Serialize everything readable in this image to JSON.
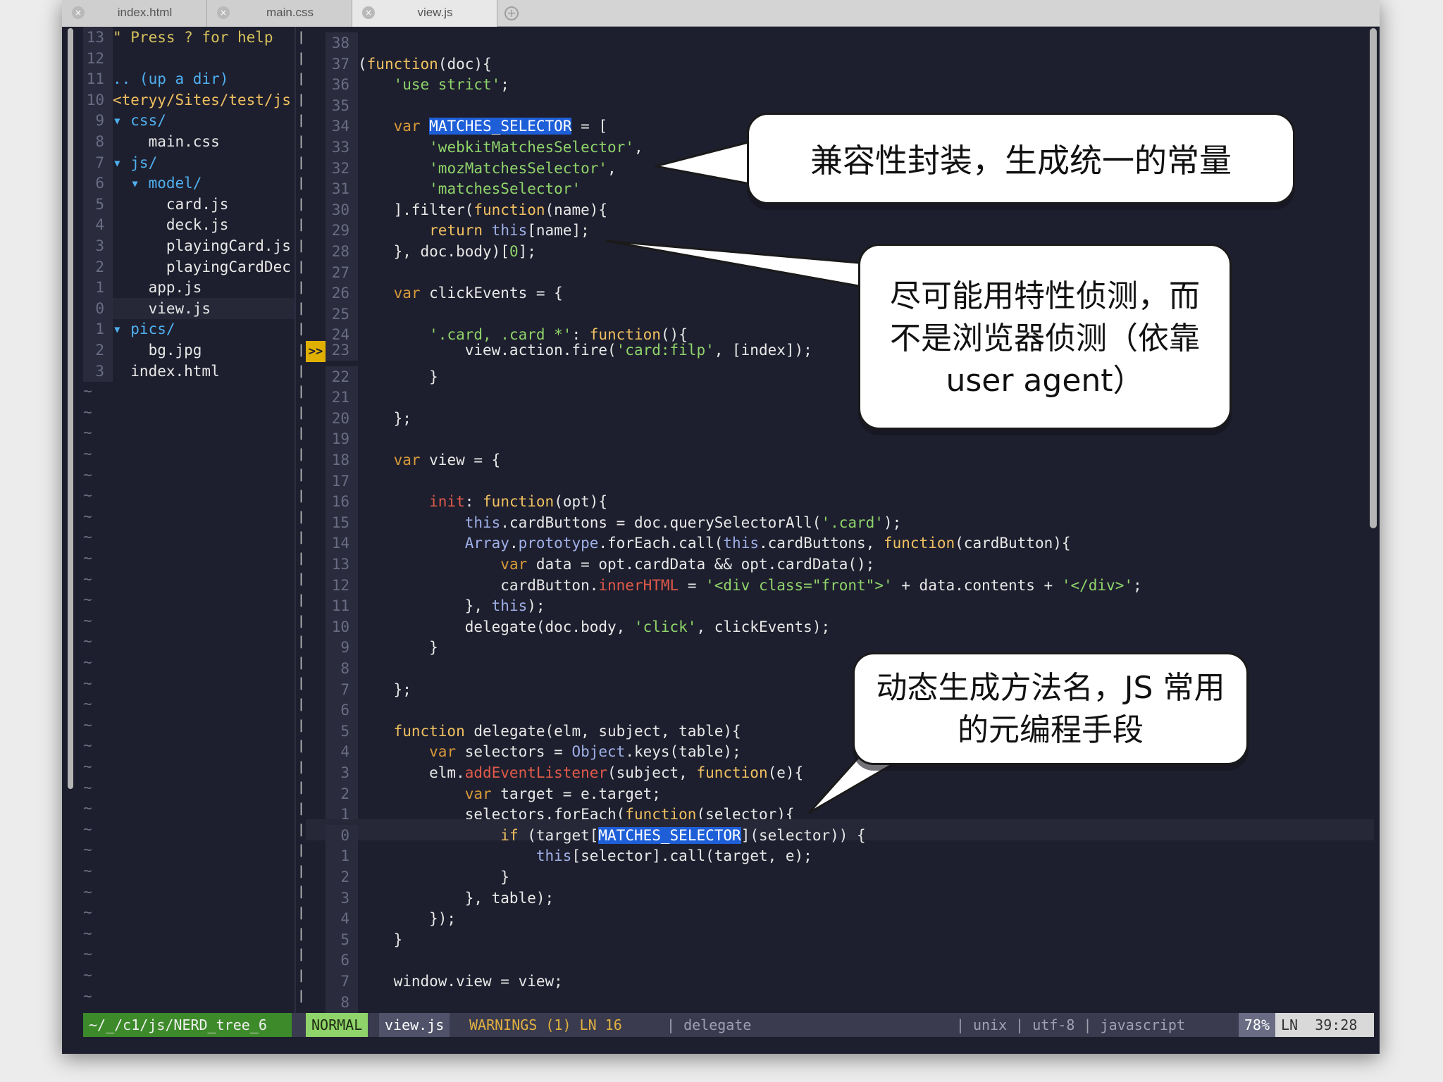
{
  "tabs": [
    {
      "label": "index.html",
      "active": false
    },
    {
      "label": "main.css",
      "active": false
    },
    {
      "label": "view.js",
      "active": true
    }
  ],
  "tree": {
    "lines": [
      {
        "n": "13",
        "text": "\" Press ? for help",
        "cls": "comment"
      },
      {
        "n": "12",
        "text": "",
        "cls": ""
      },
      {
        "n": "11",
        "text": ".. (up a dir)",
        "cls": "dir"
      },
      {
        "n": "10",
        "text": "<teryy/Sites/test/js",
        "cls": "fn"
      },
      {
        "n": "9",
        "text": "▾ css/",
        "cls": "dir"
      },
      {
        "n": "8",
        "text": "    main.css",
        "cls": ""
      },
      {
        "n": "7",
        "text": "▾ js/",
        "cls": "dir"
      },
      {
        "n": "6",
        "text": "  ▾ model/",
        "cls": "dir"
      },
      {
        "n": "5",
        "text": "      card.js",
        "cls": ""
      },
      {
        "n": "4",
        "text": "      deck.js",
        "cls": ""
      },
      {
        "n": "3",
        "text": "      playingCard.js",
        "cls": ""
      },
      {
        "n": "2",
        "text": "      playingCardDec",
        "cls": ""
      },
      {
        "n": "1",
        "text": "    app.js",
        "cls": ""
      },
      {
        "n": "0",
        "text": "    view.js",
        "cls": "",
        "current": true
      },
      {
        "n": "1",
        "text": "▾ pics/",
        "cls": "dir"
      },
      {
        "n": "2",
        "text": "    bg.jpg",
        "cls": ""
      },
      {
        "n": "3",
        "text": "  index.html",
        "cls": ""
      }
    ],
    "tilde": "~"
  },
  "code": {
    "lines": [
      {
        "n": "38",
        "t": []
      },
      {
        "n": "37",
        "t": [
          [
            "(",
            ""
          ],
          [
            "function",
            "fn"
          ],
          [
            "(doc){",
            ""
          ]
        ]
      },
      {
        "n": "36",
        "t": [
          [
            "    ",
            ""
          ],
          [
            "'use strict'",
            "str"
          ],
          [
            ";",
            ""
          ]
        ]
      },
      {
        "n": "35",
        "t": []
      },
      {
        "n": "34",
        "t": [
          [
            "    ",
            ""
          ],
          [
            "var",
            "kw"
          ],
          [
            " ",
            ""
          ],
          [
            "MATCHES_SELECTOR",
            "sel"
          ],
          [
            " = [",
            ""
          ]
        ]
      },
      {
        "n": "33",
        "t": [
          [
            "        ",
            ""
          ],
          [
            "'webkitMatchesSelector'",
            "str"
          ],
          [
            ",",
            ""
          ]
        ]
      },
      {
        "n": "32",
        "t": [
          [
            "        ",
            ""
          ],
          [
            "'mozMatchesSelector'",
            "str"
          ],
          [
            ",",
            ""
          ]
        ]
      },
      {
        "n": "31",
        "t": [
          [
            "        ",
            ""
          ],
          [
            "'matchesSelector'",
            "str"
          ]
        ]
      },
      {
        "n": "30",
        "t": [
          [
            "    ].filter(",
            ""
          ],
          [
            "function",
            "fn"
          ],
          [
            "(name){",
            ""
          ]
        ]
      },
      {
        "n": "29",
        "t": [
          [
            "        ",
            ""
          ],
          [
            "return",
            "fn"
          ],
          [
            " ",
            ""
          ],
          [
            "this",
            "obj"
          ],
          [
            "[name];",
            ""
          ]
        ]
      },
      {
        "n": "28",
        "t": [
          [
            "    }, doc.body)[",
            ""
          ],
          [
            "0",
            "str"
          ],
          [
            "];",
            ""
          ]
        ]
      },
      {
        "n": "27",
        "t": []
      },
      {
        "n": "26",
        "t": [
          [
            "    ",
            ""
          ],
          [
            "var",
            "kw"
          ],
          [
            " clickEvents = {",
            ""
          ]
        ]
      },
      {
        "n": "25",
        "t": []
      },
      {
        "n": "24",
        "t": [
          [
            "        ",
            ""
          ],
          [
            "'.card, .card *'",
            "str"
          ],
          [
            ": ",
            ""
          ],
          [
            "function",
            "fn"
          ],
          [
            "(){",
            ""
          ]
        ]
      },
      {
        "n": "23",
        "t": [
          [
            "            view.action.fire(",
            ""
          ],
          [
            "'card:filp'",
            "str"
          ],
          [
            ", [index]);",
            ""
          ]
        ],
        "warn": true
      },
      {
        "n": "22",
        "t": [
          [
            "        }",
            ""
          ]
        ]
      },
      {
        "n": "21",
        "t": []
      },
      {
        "n": "20",
        "t": [
          [
            "    };",
            ""
          ]
        ]
      },
      {
        "n": "19",
        "t": []
      },
      {
        "n": "18",
        "t": [
          [
            "    ",
            ""
          ],
          [
            "var",
            "kw"
          ],
          [
            " view = {",
            ""
          ]
        ]
      },
      {
        "n": "17",
        "t": []
      },
      {
        "n": "16",
        "t": [
          [
            "        ",
            ""
          ],
          [
            "init",
            "prop"
          ],
          [
            ": ",
            ""
          ],
          [
            "function",
            "fn"
          ],
          [
            "(opt){",
            ""
          ]
        ]
      },
      {
        "n": "15",
        "t": [
          [
            "            ",
            ""
          ],
          [
            "this",
            "obj"
          ],
          [
            ".cardButtons = doc.querySelectorAll(",
            ""
          ],
          [
            "'.card'",
            "str"
          ],
          [
            ");",
            ""
          ]
        ]
      },
      {
        "n": "14",
        "t": [
          [
            "            ",
            ""
          ],
          [
            "Array",
            "obj"
          ],
          [
            ".",
            ""
          ],
          [
            "prototype",
            "obj"
          ],
          [
            ".forEach.call(",
            ""
          ],
          [
            "this",
            "obj"
          ],
          [
            ".cardButtons, ",
            ""
          ],
          [
            "function",
            "fn"
          ],
          [
            "(cardButton){",
            ""
          ]
        ]
      },
      {
        "n": "13",
        "t": [
          [
            "                ",
            ""
          ],
          [
            "var",
            "kw"
          ],
          [
            " data = opt.cardData && opt.cardData();",
            ""
          ]
        ]
      },
      {
        "n": "12",
        "t": [
          [
            "                cardButton.",
            ""
          ],
          [
            "innerHTML",
            "prop"
          ],
          [
            " = ",
            ""
          ],
          [
            "'<div class=\"front\">'",
            "str"
          ],
          [
            " + data.contents + ",
            ""
          ],
          [
            "'</div>'",
            "str"
          ],
          [
            ";",
            ""
          ]
        ]
      },
      {
        "n": "11",
        "t": [
          [
            "            }, ",
            ""
          ],
          [
            "this",
            "obj"
          ],
          [
            ");",
            ""
          ]
        ]
      },
      {
        "n": "10",
        "t": [
          [
            "            delegate(doc.body, ",
            ""
          ],
          [
            "'click'",
            "str"
          ],
          [
            ", clickEvents);",
            ""
          ]
        ]
      },
      {
        "n": "9",
        "t": [
          [
            "        }",
            ""
          ]
        ]
      },
      {
        "n": "8",
        "t": []
      },
      {
        "n": "7",
        "t": [
          [
            "    };",
            ""
          ]
        ]
      },
      {
        "n": "6",
        "t": []
      },
      {
        "n": "5",
        "t": [
          [
            "    ",
            ""
          ],
          [
            "function",
            "fn"
          ],
          [
            " delegate(elm, subject, table){",
            ""
          ]
        ]
      },
      {
        "n": "4",
        "t": [
          [
            "        ",
            ""
          ],
          [
            "var",
            "kw"
          ],
          [
            " selectors = ",
            ""
          ],
          [
            "Object",
            "obj"
          ],
          [
            ".keys(table);",
            ""
          ]
        ]
      },
      {
        "n": "3",
        "t": [
          [
            "        elm.",
            ""
          ],
          [
            "addEventListener",
            "prop"
          ],
          [
            "(subject, ",
            ""
          ],
          [
            "function",
            "fn"
          ],
          [
            "(e){",
            ""
          ]
        ]
      },
      {
        "n": "2",
        "t": [
          [
            "            ",
            ""
          ],
          [
            "var",
            "kw"
          ],
          [
            " target = e.target;",
            ""
          ]
        ]
      },
      {
        "n": "1",
        "t": [
          [
            "            selectors.forEach(",
            ""
          ],
          [
            "function",
            "fn"
          ],
          [
            "(selector){",
            ""
          ]
        ]
      },
      {
        "n": "0",
        "t": [
          [
            "                ",
            ""
          ],
          [
            "if",
            "fn"
          ],
          [
            " (target[",
            ""
          ],
          [
            "MATCHES_SELECTOR",
            "sel"
          ],
          [
            "](selector)) {",
            ""
          ]
        ],
        "current": true
      },
      {
        "n": "1",
        "t": [
          [
            "                    ",
            ""
          ],
          [
            "this",
            "obj"
          ],
          [
            "[selector].call(target, e);",
            ""
          ]
        ]
      },
      {
        "n": "2",
        "t": [
          [
            "                }",
            ""
          ]
        ]
      },
      {
        "n": "3",
        "t": [
          [
            "            }, table);",
            ""
          ]
        ]
      },
      {
        "n": "4",
        "t": [
          [
            "        });",
            ""
          ]
        ]
      },
      {
        "n": "5",
        "t": [
          [
            "    }",
            ""
          ]
        ]
      },
      {
        "n": "6",
        "t": []
      },
      {
        "n": "7",
        "t": [
          [
            "    window.view = view;",
            ""
          ]
        ]
      },
      {
        "n": "8",
        "t": []
      }
    ]
  },
  "statusbar": {
    "path": "~/_/c1/js/NERD_tree_6",
    "mode": "NORMAL",
    "file": "view.js",
    "warnings": "WARNINGS (1) LN 16",
    "context": "| delegate",
    "info": "| unix | utf-8 | javascript",
    "percent": "78%",
    "ln_label": "LN",
    "position": "39:28"
  },
  "callouts": [
    {
      "lines": [
        "兼容性封装，生成统一的常量"
      ]
    },
    {
      "lines": [
        "尽可能用特性侦测，而",
        "不是浏览器侦测（依靠",
        "user agent）"
      ]
    },
    {
      "lines": [
        "动态生成方法名，JS 常用",
        "的元编程手段"
      ]
    }
  ],
  "colors": {
    "background": "#1e1f2e",
    "selection": "#1e5fd8",
    "string": "#8fd46a",
    "keyword": "#f0c060"
  }
}
